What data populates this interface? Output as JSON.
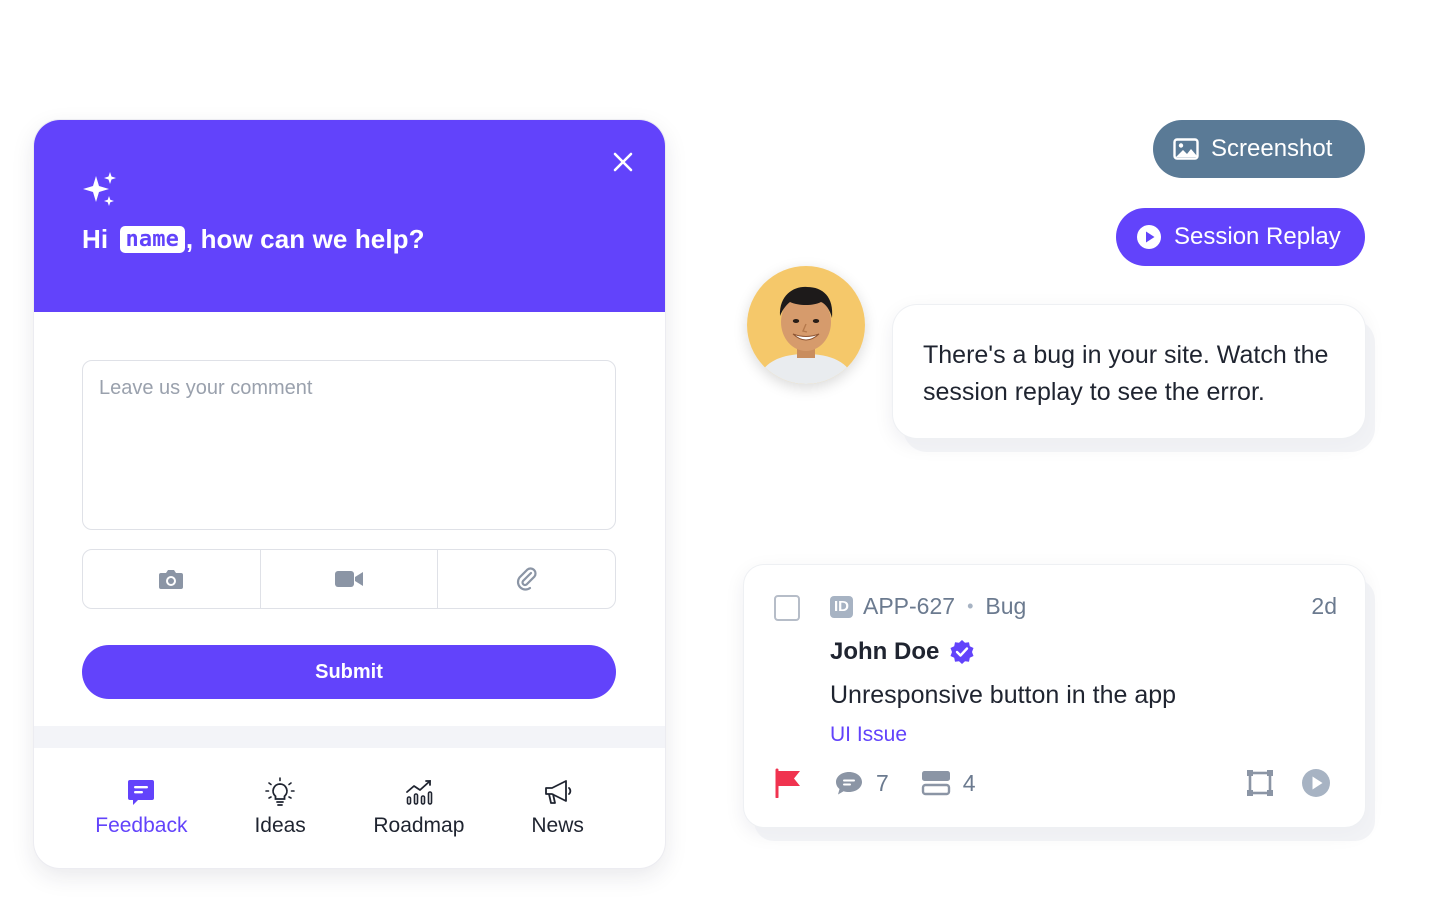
{
  "widget": {
    "greeting_prefix": "Hi",
    "greeting_name": "name",
    "greeting_suffix": ", how can we help?",
    "comment_placeholder": "Leave us your comment",
    "submit_label": "Submit",
    "attach_icons": [
      "camera-icon",
      "video-icon",
      "paperclip-icon"
    ],
    "tabs": [
      {
        "label": "Feedback",
        "icon": "feedback-icon",
        "active": true
      },
      {
        "label": "Ideas",
        "icon": "lightbulb-icon",
        "active": false
      },
      {
        "label": "Roadmap",
        "icon": "roadmap-icon",
        "active": false
      },
      {
        "label": "News",
        "icon": "megaphone-icon",
        "active": false
      }
    ]
  },
  "buttons": {
    "screenshot_label": "Screenshot",
    "session_replay_label": "Session Replay"
  },
  "message": {
    "text": "There's a bug in your site. Watch the session replay to see the error."
  },
  "issue_card": {
    "id_badge": "ID",
    "id": "APP-627",
    "type": "Bug",
    "age": "2d",
    "author": "John Doe",
    "title": "Unresponsive button in the app",
    "tag": "UI Issue",
    "comments_count": "7",
    "items_count": "4"
  },
  "colors": {
    "brand": "#6243fb",
    "screenshot_pill": "#5a7a96",
    "flag": "#f0334f",
    "muted_text": "#6b7a8f"
  }
}
